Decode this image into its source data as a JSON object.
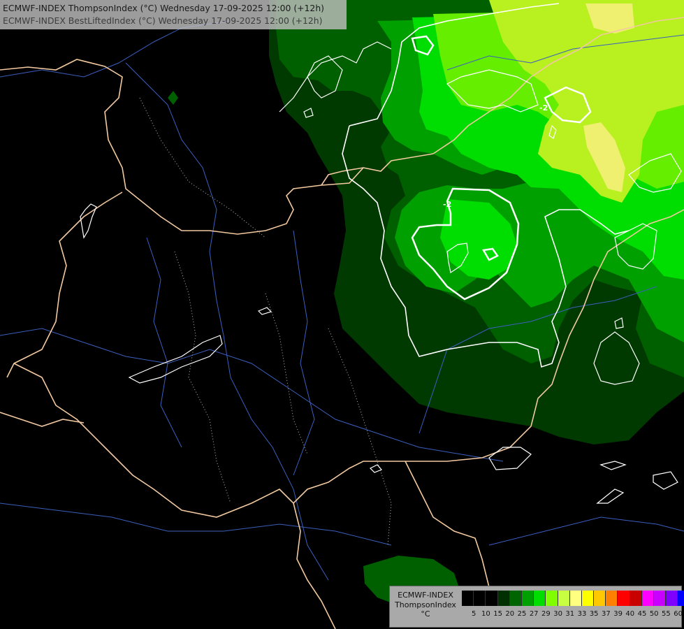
{
  "header": {
    "line1": "ECMWF-INDEX ThompsonIndex (°C) Wednesday 17-09-2025 12:00 (+12h)",
    "line2": "ECMWF-INDEX BestLiftedIndex (°C) Wednesday 17-09-2025 12:00 (+12h)"
  },
  "map": {
    "contour_labels": [
      "-2",
      "-2"
    ],
    "colors": {
      "background": "#000000",
      "border": "#f2c9a0",
      "river": "#3b5fbf",
      "contour": "#ffffff"
    }
  },
  "legend": {
    "title_line1": "ECMWF-INDEX",
    "title_line2": "ThompsonIndex",
    "unit": "°C",
    "bins": [
      {
        "label": "5",
        "color": "#000000"
      },
      {
        "label": "10",
        "color": "#000000"
      },
      {
        "label": "15",
        "color": "#000000"
      },
      {
        "label": "20",
        "color": "#003000"
      },
      {
        "label": "25",
        "color": "#006400"
      },
      {
        "label": "27",
        "color": "#00a000"
      },
      {
        "label": "29",
        "color": "#00dd00"
      },
      {
        "label": "30",
        "color": "#80ff00"
      },
      {
        "label": "31",
        "color": "#c8ff40"
      },
      {
        "label": "33",
        "color": "#ffff80"
      },
      {
        "label": "35",
        "color": "#ffff00"
      },
      {
        "label": "37",
        "color": "#ffc800"
      },
      {
        "label": "39",
        "color": "#ff8000"
      },
      {
        "label": "40",
        "color": "#ff0000"
      },
      {
        "label": "45",
        "color": "#c80000"
      },
      {
        "label": "50",
        "color": "#ff00ff"
      },
      {
        "label": "55",
        "color": "#c800ff"
      },
      {
        "label": "60",
        "color": "#8000ff"
      },
      {
        "label": "",
        "color": "#0000ff"
      }
    ]
  }
}
